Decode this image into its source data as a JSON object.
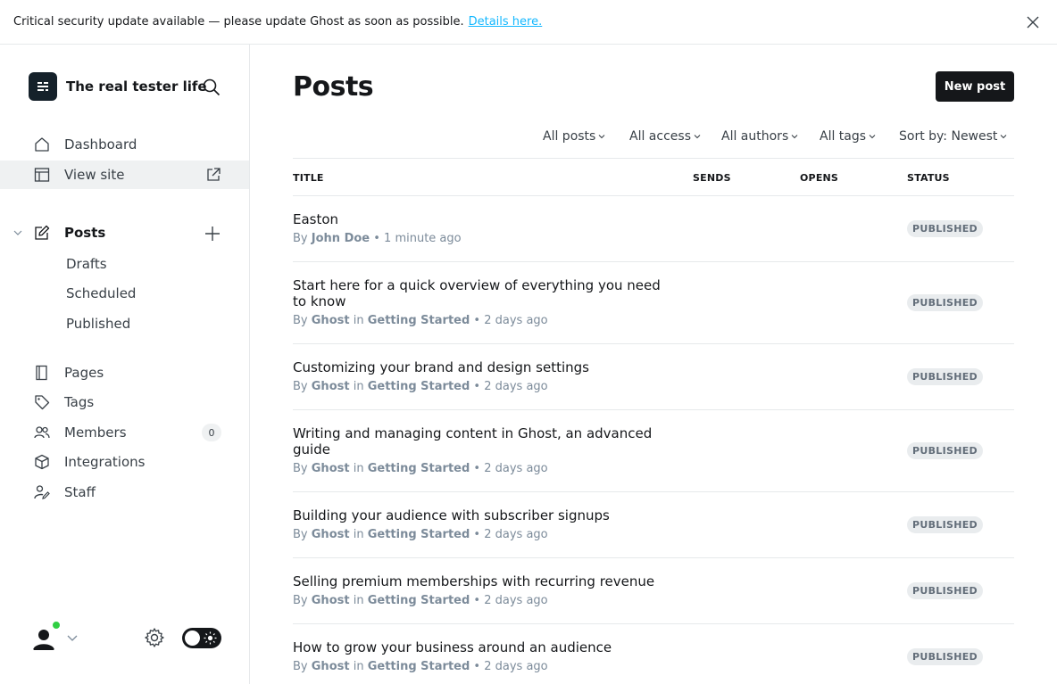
{
  "banner": {
    "message": "Critical security update available — please update Ghost as soon as possible.",
    "link": "Details here."
  },
  "site": {
    "title": "The real tester life"
  },
  "nav": {
    "dashboard": "Dashboard",
    "view_site": "View site",
    "posts": "Posts",
    "drafts": "Drafts",
    "scheduled": "Scheduled",
    "published": "Published",
    "pages": "Pages",
    "tags": "Tags",
    "members": "Members",
    "members_count": "0",
    "integrations": "Integrations",
    "staff": "Staff"
  },
  "main": {
    "title": "Posts",
    "new_post": "New post",
    "filters": {
      "type": "All posts",
      "access": "All access",
      "authors": "All authors",
      "tags": "All tags",
      "sort": "Sort by: Newest"
    },
    "columns": {
      "title": "TITLE",
      "sends": "SENDS",
      "opens": "OPENS",
      "status": "STATUS"
    },
    "posts": [
      {
        "title": "Easton",
        "by": "By",
        "author": "John Doe",
        "in": "",
        "tag": "",
        "time": "1 minute ago",
        "status": "PUBLISHED"
      },
      {
        "title": "Start here for a quick overview of everything you need to know",
        "by": "By",
        "author": "Ghost",
        "in": "in",
        "tag": "Getting Started",
        "time": "2 days ago",
        "status": "PUBLISHED"
      },
      {
        "title": "Customizing your brand and design settings",
        "by": "By",
        "author": "Ghost",
        "in": "in",
        "tag": "Getting Started",
        "time": "2 days ago",
        "status": "PUBLISHED"
      },
      {
        "title": "Writing and managing content in Ghost, an advanced guide",
        "by": "By",
        "author": "Ghost",
        "in": "in",
        "tag": "Getting Started",
        "time": "2 days ago",
        "status": "PUBLISHED"
      },
      {
        "title": "Building your audience with subscriber signups",
        "by": "By",
        "author": "Ghost",
        "in": "in",
        "tag": "Getting Started",
        "time": "2 days ago",
        "status": "PUBLISHED"
      },
      {
        "title": "Selling premium memberships with recurring revenue",
        "by": "By",
        "author": "Ghost",
        "in": "in",
        "tag": "Getting Started",
        "time": "2 days ago",
        "status": "PUBLISHED"
      },
      {
        "title": "How to grow your business around an audience",
        "by": "By",
        "author": "Ghost",
        "in": "in",
        "tag": "Getting Started",
        "time": "2 days ago",
        "status": "PUBLISHED"
      }
    ]
  },
  "colors": {
    "accent": "#14b8ff",
    "online": "#30cf43",
    "primary": "#15171a",
    "muted": "#7c8b9a"
  }
}
